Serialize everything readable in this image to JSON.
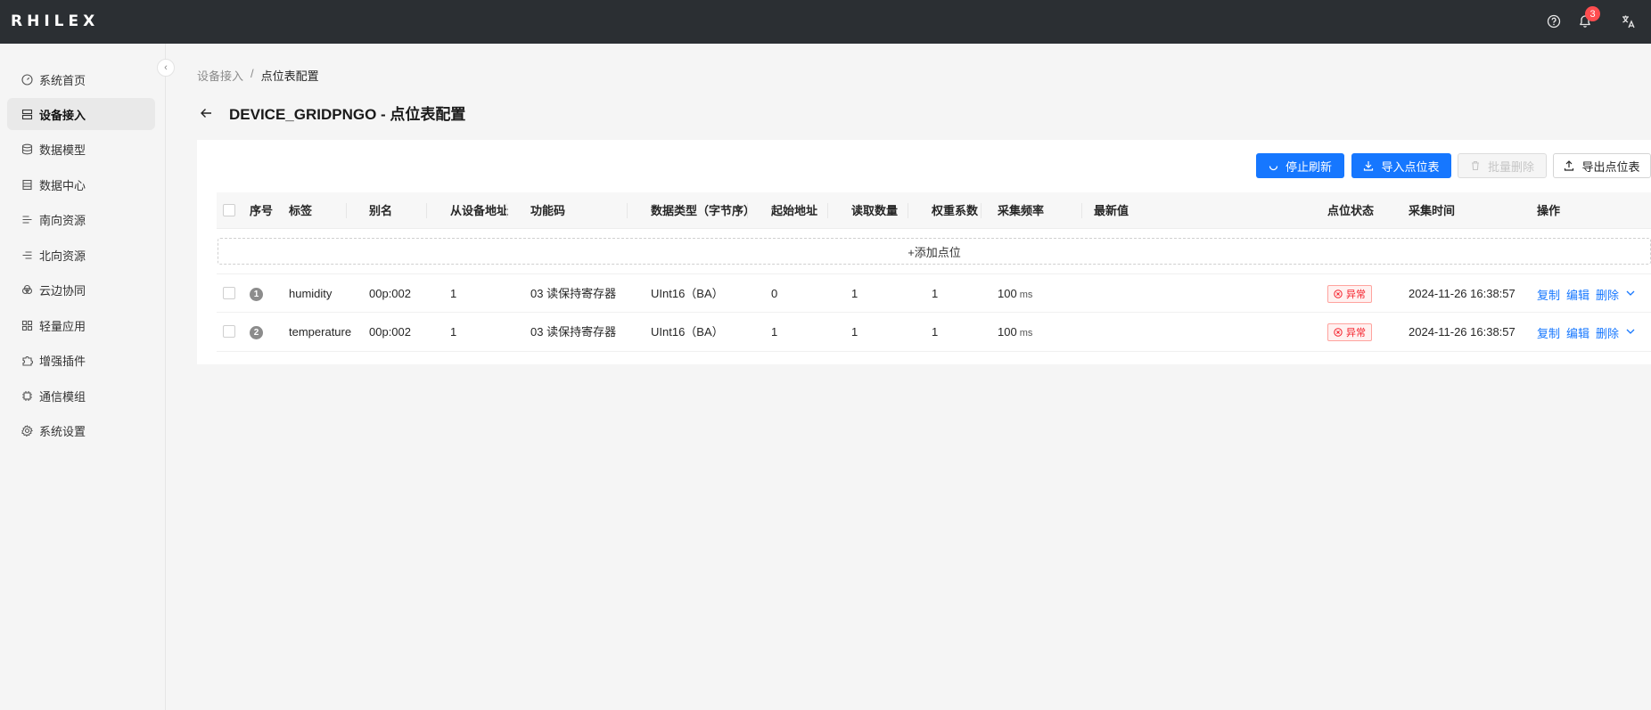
{
  "app": {
    "logo": "RHILEX",
    "notification_count": "3"
  },
  "sidebar": {
    "items": [
      {
        "label": "系统首页",
        "icon": "dashboard-icon"
      },
      {
        "label": "设备接入",
        "icon": "device-icon",
        "active": true
      },
      {
        "label": "数据模型",
        "icon": "model-icon"
      },
      {
        "label": "数据中心",
        "icon": "database-icon"
      },
      {
        "label": "南向资源",
        "icon": "south-resource-icon"
      },
      {
        "label": "北向资源",
        "icon": "north-resource-icon"
      },
      {
        "label": "云边协同",
        "icon": "cloud-icon"
      },
      {
        "label": "轻量应用",
        "icon": "app-icon"
      },
      {
        "label": "增强插件",
        "icon": "plugin-icon"
      },
      {
        "label": "通信模组",
        "icon": "chip-icon"
      },
      {
        "label": "系统设置",
        "icon": "gear-icon"
      }
    ]
  },
  "breadcrumb": {
    "parent": "设备接入",
    "separator": "/",
    "current": "点位表配置"
  },
  "page": {
    "title": "DEVICE_GRIDPNGO - 点位表配置"
  },
  "toolbar": {
    "stop_refresh": "停止刷新",
    "import": "导入点位表",
    "batch_delete": "批量删除",
    "export": "导出点位表"
  },
  "table": {
    "headers": {
      "index": "序号",
      "tag": "标签",
      "alias": "别名",
      "slave_addr": "从设备地址",
      "func_code": "功能码",
      "data_type": "数据类型（字节序）",
      "start_addr": "起始地址",
      "read_count": "读取数量",
      "weight": "权重系数",
      "freq": "采集频率",
      "latest": "最新值",
      "status": "点位状态",
      "time": "采集时间",
      "ops": "操作"
    },
    "add_label": "+添加点位",
    "rows": [
      {
        "index": "1",
        "tag": "humidity",
        "alias": "00p:002",
        "slave_addr": "1",
        "func_code": "03 读保持寄存器",
        "data_type": "UInt16（BA）",
        "start_addr": "0",
        "read_count": "1",
        "weight": "1",
        "freq": "100",
        "freq_unit": "ms",
        "latest": "",
        "status": "异常",
        "time": "2024-11-26 16:38:57",
        "op_copy": "复制",
        "op_edit": "编辑",
        "op_delete": "删除"
      },
      {
        "index": "2",
        "tag": "temperature",
        "alias": "00p:002",
        "slave_addr": "1",
        "func_code": "03 读保持寄存器",
        "data_type": "UInt16（BA）",
        "start_addr": "1",
        "read_count": "1",
        "weight": "1",
        "freq": "100",
        "freq_unit": "ms",
        "latest": "",
        "status": "异常",
        "time": "2024-11-26 16:38:57",
        "op_copy": "复制",
        "op_edit": "编辑",
        "op_delete": "删除"
      }
    ]
  },
  "colors": {
    "primary": "#1677ff",
    "topbar": "#2b2f33",
    "error": "#f5222d",
    "badge": "#ff4d4f"
  }
}
